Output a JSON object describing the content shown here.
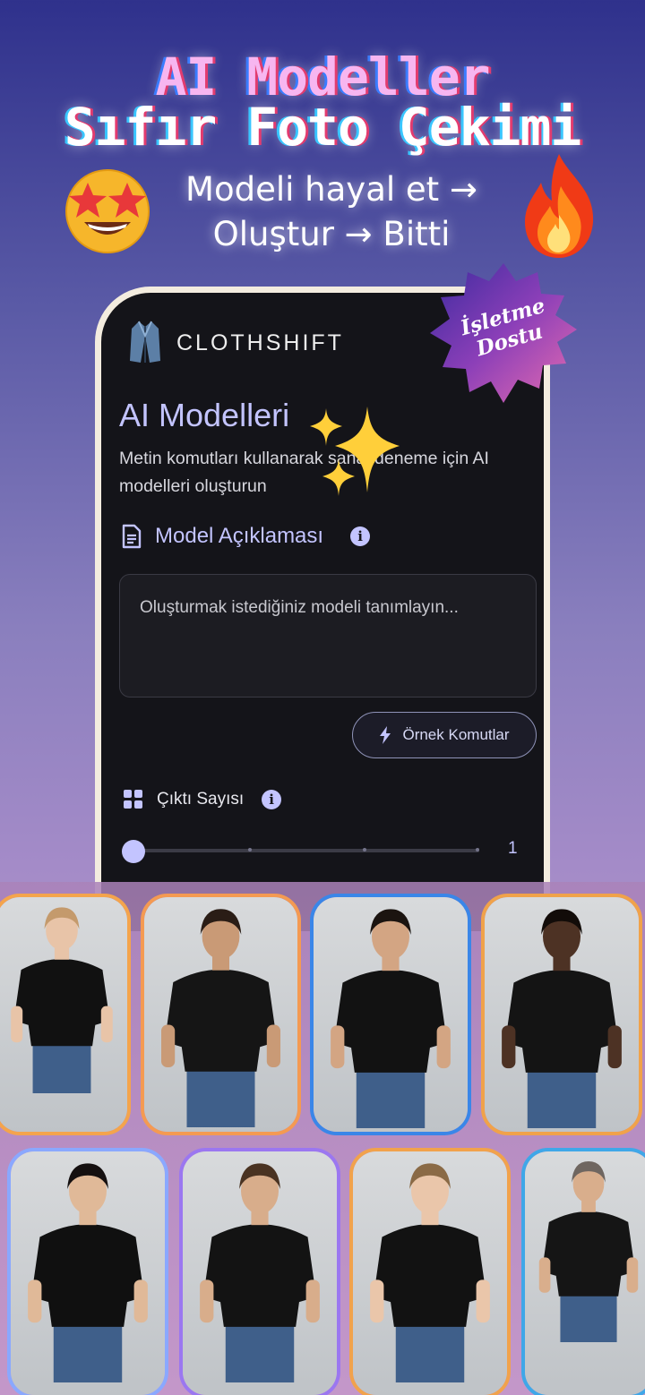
{
  "headline": {
    "line1": "AI Modeller",
    "line2": "Sıfır Foto Çekimi",
    "sub1": "Modeli hayal et →",
    "sub2": "Oluştur → Bitti"
  },
  "emoji": {
    "left": "star-struck-face-icon",
    "right": "fire-icon",
    "sparkles": "sparkles-icon"
  },
  "badge": {
    "line1": "İşletme",
    "line2": "Dostu"
  },
  "app": {
    "brand": "CLOTHSHIFT",
    "title": "AI Modelleri",
    "description": "Metin komutları kullanarak sanal deneme için AI modelleri oluşturun",
    "model_section": {
      "label": "Model Açıklaması",
      "icon": "document-icon"
    },
    "textarea_placeholder": "Oluşturmak istediğiniz modeli tanımlayın...",
    "example_button": {
      "label": "Örnek Komutlar",
      "icon": "lightning-icon"
    },
    "output_section": {
      "label": "Çıktı Sayısı",
      "icon": "grid-icon"
    },
    "slider": {
      "value": "1",
      "min": 1,
      "max": 4
    }
  },
  "colors": {
    "accent": "#c3c4ff",
    "phone_bg": "#141419",
    "badge": "#8b3fb8"
  },
  "photos": [
    {
      "shirt": "#111111",
      "skin": "#e8c4a8",
      "hair": "#c49a6c"
    },
    {
      "shirt": "#151515",
      "skin": "#c99a76",
      "hair": "#2a1d16"
    },
    {
      "shirt": "#121212",
      "skin": "#d3a583",
      "hair": "#1b1410"
    },
    {
      "shirt": "#141414",
      "skin": "#4d3224",
      "hair": "#120c09"
    },
    {
      "shirt": "#101010",
      "skin": "#e0b998",
      "hair": "#151010"
    },
    {
      "shirt": "#131313",
      "skin": "#d8ad8b",
      "hair": "#4a3322"
    },
    {
      "shirt": "#121212",
      "skin": "#eac6aa",
      "hair": "#8a6a46"
    },
    {
      "shirt": "#151515",
      "skin": "#d9ae8c",
      "hair": "#6f6660"
    }
  ]
}
